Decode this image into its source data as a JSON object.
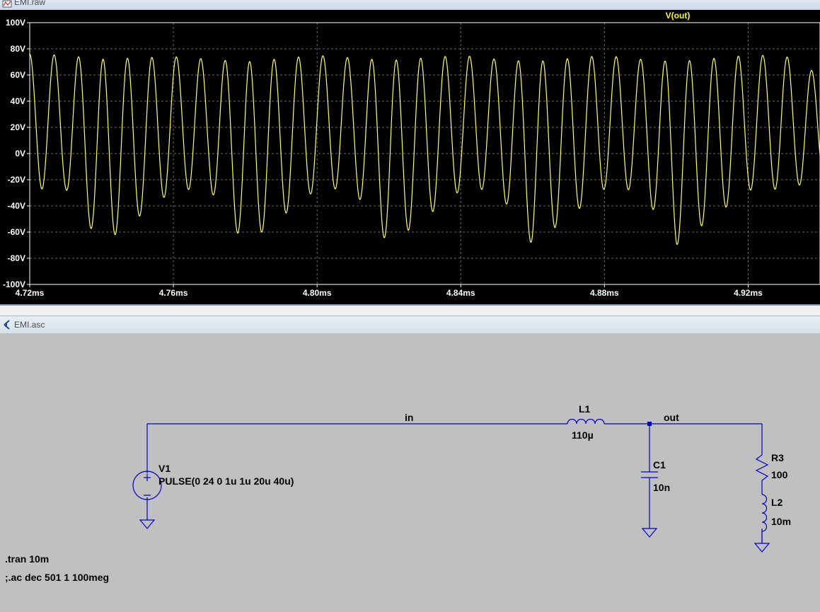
{
  "waveform_window": {
    "title": "EMI.raw",
    "trace_label": "V(out)",
    "trace_color": "#ffff66",
    "y_ticks": [
      "100V",
      "80V",
      "60V",
      "40V",
      "20V",
      "0V",
      "-20V",
      "-40V",
      "-60V",
      "-80V",
      "-100V"
    ],
    "x_ticks": [
      "4.72ms",
      "4.76ms",
      "4.80ms",
      "4.84ms",
      "4.88ms",
      "4.92ms"
    ]
  },
  "schematic_window": {
    "title": "EMI.asc",
    "wire_color": "#0000cc",
    "nets": {
      "in": "in",
      "out": "out"
    },
    "components": {
      "V1": {
        "name": "V1",
        "value": "PULSE(0 24 0 1u 1u 20u 40u)"
      },
      "L1": {
        "name": "L1",
        "value": "110µ"
      },
      "C1": {
        "name": "C1",
        "value": "10n"
      },
      "R3": {
        "name": "R3",
        "value": "100"
      },
      "L2": {
        "name": "L2",
        "value": "10m"
      }
    },
    "directives": [
      ".tran 10m",
      ";.ac dec 501 1 100meg"
    ]
  },
  "chart_data": {
    "type": "line",
    "title": "V(out)",
    "xlabel": "",
    "ylabel": "",
    "xlim": [
      4.72,
      4.94
    ],
    "ylim": [
      -100,
      100
    ],
    "x_unit": "ms",
    "y_unit": "V",
    "grid": true,
    "series": [
      {
        "name": "V(out)",
        "color": "#ffff66",
        "envelope": [
          {
            "t": 4.72,
            "max": 76,
            "min": -27
          },
          {
            "t": 4.73,
            "max": 75,
            "min": -27
          },
          {
            "t": 4.74,
            "max": 72,
            "min": -70
          },
          {
            "t": 4.76,
            "max": 74,
            "min": -28
          },
          {
            "t": 4.77,
            "max": 72,
            "min": -27
          },
          {
            "t": 4.78,
            "max": 70,
            "min": -70
          },
          {
            "t": 4.8,
            "max": 75,
            "min": -27
          },
          {
            "t": 4.81,
            "max": 73,
            "min": -27
          },
          {
            "t": 4.82,
            "max": 71,
            "min": -70
          },
          {
            "t": 4.84,
            "max": 75,
            "min": -28
          },
          {
            "t": 4.85,
            "max": 72,
            "min": -27
          },
          {
            "t": 4.86,
            "max": 70,
            "min": -70
          },
          {
            "t": 4.88,
            "max": 75,
            "min": -27
          },
          {
            "t": 4.89,
            "max": 72,
            "min": -28
          },
          {
            "t": 4.9,
            "max": 70,
            "min": -70
          },
          {
            "t": 4.92,
            "max": 75,
            "min": -28
          },
          {
            "t": 4.93,
            "max": 75,
            "min": -27
          },
          {
            "t": 4.94,
            "max": 60,
            "min": -20
          }
        ],
        "cycles_per_ms": 147
      }
    ]
  }
}
